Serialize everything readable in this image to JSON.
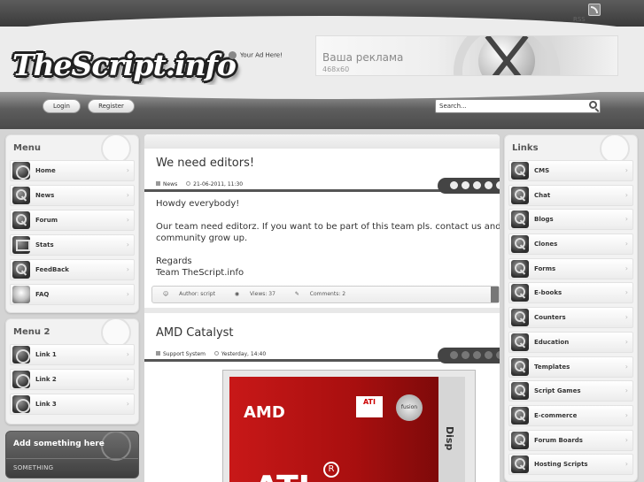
{
  "header": {
    "rss_label": "RSS",
    "logo_text": "TheScript.info",
    "ad_here": "Your Ad Here!",
    "banner_title": "Ваша реклама",
    "banner_size": "468x60"
  },
  "nav": {
    "login": "Login",
    "register": "Register",
    "search_value": "Search..."
  },
  "menu": {
    "title": "Menu",
    "items": [
      {
        "label": "Home",
        "icon": "film-reel-icon"
      },
      {
        "label": "News",
        "icon": "magnifier-icon"
      },
      {
        "label": "Forum",
        "icon": "magnifier-icon"
      },
      {
        "label": "Stats",
        "icon": "monitor-icon"
      },
      {
        "label": "FeedBack",
        "icon": "magnifier-icon"
      },
      {
        "label": "FAQ",
        "icon": "lightbulb-icon"
      }
    ]
  },
  "menu2": {
    "title": "Menu 2",
    "items": [
      {
        "label": "Link 1"
      },
      {
        "label": "Link 2"
      },
      {
        "label": "Link 3"
      }
    ]
  },
  "promo": {
    "title": "Add something here",
    "sub": "SOMETHING"
  },
  "posts": [
    {
      "title": "We need editors!",
      "category": "News",
      "date": "21-06-2011, 11:30",
      "body": [
        "Howdy everybody!",
        "",
        "Our team need editorz. If you want to be part of this team pls. contact us and help the",
        "community grow up.",
        "",
        "Regards",
        "Team TheScript.info"
      ],
      "author": "Author: script",
      "views": "Views: 37",
      "comments": "Comments: 2"
    },
    {
      "title": "AMD Catalyst",
      "category": "Support System",
      "date": "Yesterday, 14:40",
      "image": {
        "amd": "AMD",
        "ati_badge": "ATI",
        "fusion": "fusion",
        "ati_big": "ATI",
        "reg": "R",
        "side": "Disp"
      }
    }
  ],
  "links": {
    "title": "Links",
    "items": [
      "CMS",
      "Chat",
      "Blogs",
      "Clones",
      "Forms",
      "E-books",
      "Counters",
      "Education",
      "Templates",
      "Script Games",
      "E-commerce",
      "Forum Boards",
      "Hosting Scripts"
    ]
  },
  "colors": {
    "accent": "#444444",
    "background": "#d4d4d4"
  }
}
